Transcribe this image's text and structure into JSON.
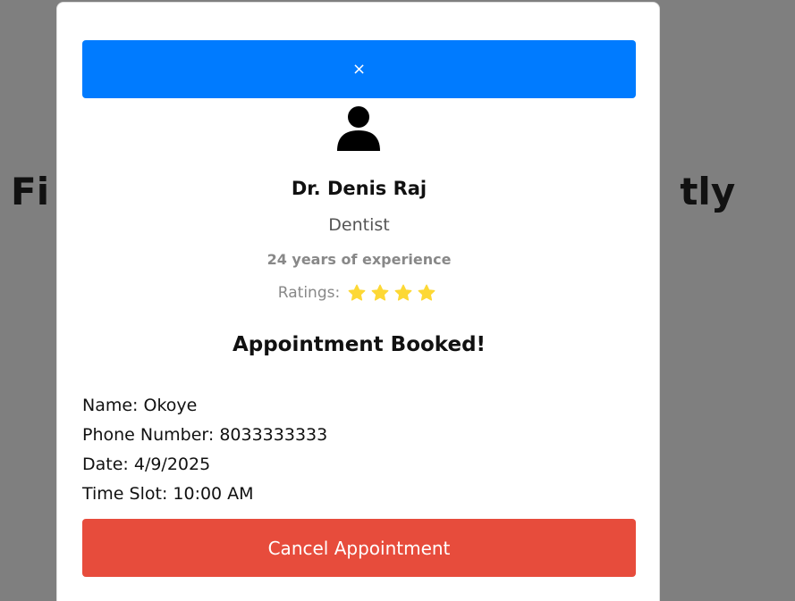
{
  "background": {
    "heading_left": "Fi",
    "heading_right": "tly"
  },
  "modal": {
    "close_label": "×",
    "doctor": {
      "name": "Dr. Denis Raj",
      "specialty": "Dentist",
      "experience": "24 years of experience",
      "ratings_label": "Ratings:",
      "stars": 4
    },
    "booked_title": "Appointment Booked!",
    "details": {
      "name": "Name: Okoye",
      "phone": "Phone Number: 8033333333",
      "date": "Date: 4/9/2025",
      "time_slot": "Time Slot: 10:00 AM"
    },
    "cancel_label": "Cancel Appointment"
  },
  "colors": {
    "close_bar": "#007bff",
    "cancel_button": "#e74c3c",
    "star": "#fdd835",
    "overlay": "rgba(0,0,0,0.5)"
  },
  "icons": {
    "avatar": "user-icon",
    "star": "star-icon"
  }
}
